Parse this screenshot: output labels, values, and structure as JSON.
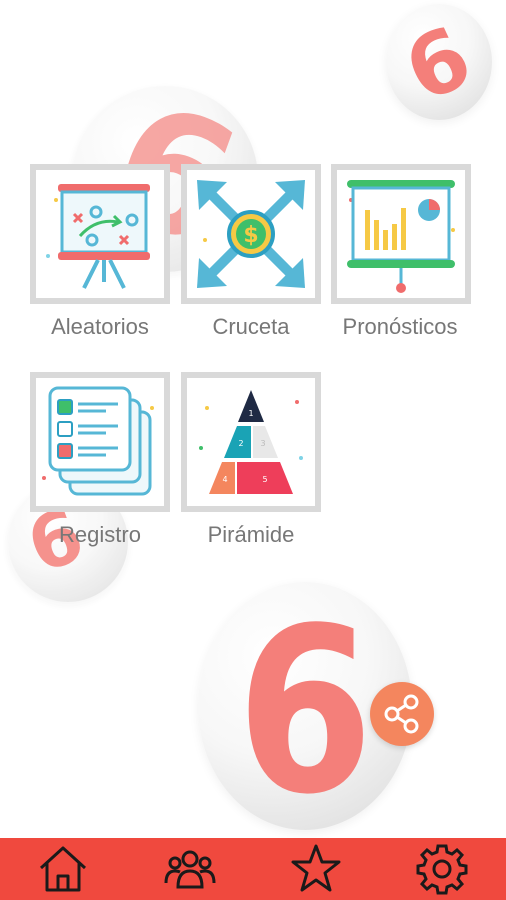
{
  "menu": {
    "items": [
      {
        "label": "Aleatorios",
        "icon": "strategy-board-icon"
      },
      {
        "label": "Cruceta",
        "icon": "money-arrows-icon"
      },
      {
        "label": "Pronósticos",
        "icon": "presentation-chart-icon"
      },
      {
        "label": "Registro",
        "icon": "checklist-icon"
      },
      {
        "label": "Pirámide",
        "icon": "pyramid-icon"
      }
    ],
    "pyramid_levels": [
      "1",
      "2",
      "3",
      "4",
      "5"
    ]
  },
  "background": {
    "ball_digit": "6"
  },
  "share": {
    "icon": "share-icon"
  },
  "bottom_nav": {
    "items": [
      {
        "icon": "home-icon"
      },
      {
        "icon": "users-icon"
      },
      {
        "icon": "star-icon"
      },
      {
        "icon": "settings-icon"
      }
    ]
  },
  "colors": {
    "accent_red": "#f0493e",
    "share_orange": "#f4865e",
    "ball_digit": "#f47f7a",
    "label_gray": "#777777"
  }
}
